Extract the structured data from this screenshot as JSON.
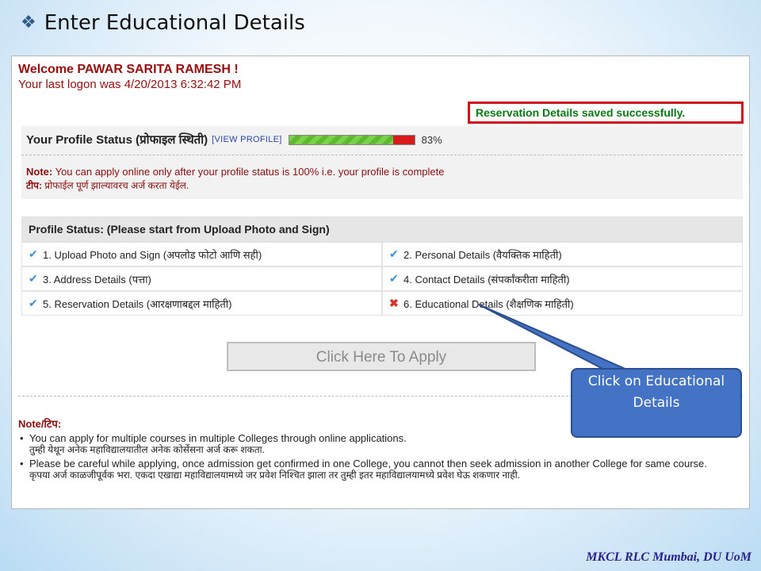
{
  "slide": {
    "bullet": "❖",
    "title": "Enter Educational Details",
    "footer": "MKCL RLC Mumbai, DU UoM"
  },
  "welcome": {
    "line1": "Welcome PAWAR SARITA RAMESH !",
    "line2": "Your last logon was 4/20/2013 6:32:42 PM"
  },
  "success_message": "Reservation Details saved successfully.",
  "profile": {
    "label": "Your Profile Status (प्रोफाइल स्थिती)",
    "view_link": "[VIEW PROFILE]",
    "progress_fraction": 0.83,
    "progress_text": "83%",
    "note_label": "Note:",
    "note_text": " You can apply online only after your profile status is 100% i.e. your profile is complete",
    "note_hindi_label": "टीप:",
    "note_hindi_text": " प्रोफाईल पूर्ण झाल्यावरच अर्ज करता येईल."
  },
  "profile_status": {
    "header": "Profile Status: (Please start from Upload Photo and Sign)",
    "items": [
      {
        "status": "✔",
        "state": "ok",
        "label": "1. Upload Photo and Sign (अपलोड फोटो आणि सही)"
      },
      {
        "status": "✔",
        "state": "ok",
        "label": "2. Personal Details (वैयक्तिक माहिती)"
      },
      {
        "status": "✔",
        "state": "ok",
        "label": "3. Address Details (पत्ता)"
      },
      {
        "status": "✔",
        "state": "ok",
        "label": "4. Contact Details (संपर्कांकरीता माहिती)"
      },
      {
        "status": "✔",
        "state": "ok",
        "label": "5. Reservation Details (आरक्षणाबद्दल माहिती)"
      },
      {
        "status": "✖",
        "state": "bad",
        "label": "6. Educational Details (शैक्षणिक माहिती)"
      }
    ]
  },
  "apply_button": "Click Here To Apply",
  "notes": {
    "title": "Note/टिप:",
    "items": [
      {
        "en": "You can apply for multiple courses in multiple Colleges through online applications.",
        "hi": "तुम्ही येथून अनेक महाविद्यालयातील अनेक कोर्सेसना अर्ज करू शकता."
      },
      {
        "en": "Please be careful while applying, once admission get confirmed in one College, you cannot then seek admission in another College for same course.",
        "hi": "कृपया अर्ज काळजीपूर्वक भरा. एकदा एखाद्या महाविद्यालयामध्ये जर प्रवेश निश्चित झाला तर तुम्ही इतर महाविद्यालयामध्ये प्रवेश घेऊ शकणार नाही."
      }
    ]
  },
  "callout": {
    "text": "Click on Educational Details"
  },
  "colors": {
    "accent_red": "#9b0d0d",
    "success_green": "#0a7a14",
    "callout_blue": "#4472c4",
    "check_blue": "#3d8fd6",
    "cross_red": "#d9342b"
  },
  "icons": {
    "bullet": "diamond-bullet-icon",
    "ok": "checkmark-icon",
    "bad": "cross-icon"
  }
}
